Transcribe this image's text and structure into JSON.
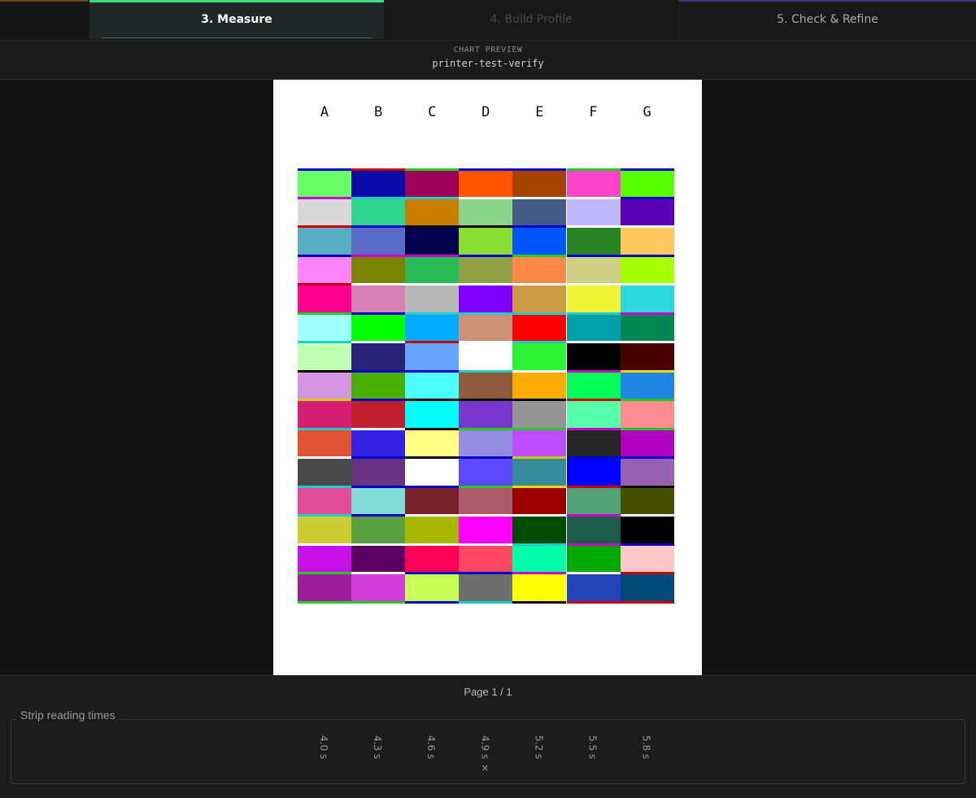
{
  "tabs": [
    {
      "label": "3. Measure",
      "state": "active"
    },
    {
      "label": "4. Build Profile",
      "state": "disabled"
    },
    {
      "label": "5. Check & Refine",
      "state": "normal"
    }
  ],
  "preview": {
    "label": "CHART PREVIEW",
    "name": "printer-test-verify"
  },
  "chart": {
    "columns": [
      "A",
      "B",
      "C",
      "D",
      "E",
      "F",
      "G"
    ],
    "rows": [
      [
        "#66ff66",
        "#0a0aa8",
        "#9e0058",
        "#ff5500",
        "#a44400",
        "#ff44cc",
        "#55ff00"
      ],
      [
        "#d9d9d9",
        "#2ed68f",
        "#c97e00",
        "#8ad48a",
        "#425a84",
        "#c0b8ff",
        "#5a00b4"
      ],
      [
        "#58acc4",
        "#5a6cc8",
        "#00004c",
        "#8ade33",
        "#0056ff",
        "#2a8428",
        "#ffc85c"
      ],
      [
        "#ff84ff",
        "#7a8400",
        "#28bc58",
        "#92a045",
        "#ff8848",
        "#d0d084",
        "#a8ff00"
      ],
      [
        "#ff0090",
        "#d680b4",
        "#b8b8b8",
        "#8000ff",
        "#cc9a44",
        "#f0f234",
        "#2cd8dc"
      ],
      [
        "#a0fffc",
        "#00ff00",
        "#00aaff",
        "#cc9076",
        "#ff0000",
        "#00a0a8",
        "#008652"
      ],
      [
        "#c0ffb4",
        "#2a2278",
        "#66a4ff",
        "#ffffff",
        "#2cf234",
        "#000000",
        "#480000"
      ],
      [
        "#d496e2",
        "#48ae00",
        "#4effff",
        "#8c5c3c",
        "#ffaa00",
        "#00ff56",
        "#1e86e2"
      ],
      [
        "#d61e74",
        "#c02030",
        "#00ffff",
        "#7838cc",
        "#949494",
        "#56ffaa",
        "#ff8c8e"
      ],
      [
        "#e05434",
        "#3420e2",
        "#ffff84",
        "#968ce2",
        "#bc4cff",
        "#262626",
        "#b000c0"
      ],
      [
        "#4a4a4a",
        "#6a3282",
        "#ffffff",
        "#5c48ff",
        "#368a98",
        "#0000ff",
        "#9860b0"
      ],
      [
        "#e04c9a",
        "#80dad8",
        "#78222c",
        "#ac5a6c",
        "#9c0000",
        "#54a27a",
        "#445000"
      ],
      [
        "#cccc34",
        "#5aa042",
        "#a8b800",
        "#ff00ff",
        "#004a00",
        "#1e5c4a",
        "#000000"
      ],
      [
        "#c810e8",
        "#5a0060",
        "#ff0056",
        "#ff4660",
        "#00ffa8",
        "#00aa00",
        "#ffc8c8"
      ],
      [
        "#9c1c9a",
        "#d43cdc",
        "#c8ff56",
        "#6e6e6e",
        "#ffff00",
        "#2244b8",
        "#004a78"
      ]
    ],
    "dividers": [
      [
        "#0000cc",
        "#cc0000",
        "#22cc22",
        "#0000cc",
        "#0000cc",
        "#22cc22",
        "#0000cc"
      ],
      [
        "#cc00cc",
        "#22cccc",
        "#22cccc",
        "#ffffff",
        "#ffffff",
        "#ffffff",
        "#0000cc"
      ],
      [
        "#cc0000",
        "#0000cc",
        "#000000",
        "#000000",
        "#0000cc",
        "#ffffff",
        "#ffffff"
      ],
      [
        "#0000cc",
        "#cc00cc",
        "#cc00cc",
        "#0000cc",
        "#22cc22",
        "#0000cc",
        "#0000cc"
      ],
      [
        "#cc0000",
        "#ffffff",
        "#ffffff",
        "#ffffff",
        "#ffffff",
        "#ffffff",
        "#ffffff"
      ],
      [
        "#22cc22",
        "#0000cc",
        "#22cccc",
        "#22cccc",
        "#22cccc",
        "#22cccc",
        "#cc00cc"
      ],
      [
        "#22cccc",
        "#ffffff",
        "#cc0000",
        "#ffffff",
        "#22cccc",
        "#ffffff",
        "#ffffff"
      ],
      [
        "#000000",
        "#0000cc",
        "#0000cc",
        "#22cccc",
        "#ffffff",
        "#cc00cc",
        "#ffd700"
      ],
      [
        "#cccc00",
        "#0000cc",
        "#000000",
        "#000000",
        "#000000",
        "#cc0000",
        "#22cc22"
      ],
      [
        "#22cccc",
        "#ffffff",
        "#000000",
        "#22cc22",
        "#22cc22",
        "#cc00cc",
        "#22cc22"
      ],
      [
        "#ffffff",
        "#0000cc",
        "#000000",
        "#0000cc",
        "#cccc00",
        "#0000cc",
        "#0000cc"
      ],
      [
        "#22cccc",
        "#0000cc",
        "#0000cc",
        "#22cc22",
        "#ffd700",
        "#cc0000",
        "#000000"
      ],
      [
        "#22cccc",
        "#0000cc",
        "#ffffff",
        "#ffffff",
        "#ffffff",
        "#cc00cc",
        "#ffffff"
      ],
      [
        "#ffffff",
        "#ffffff",
        "#ffffff",
        "#ffffff",
        "#22cccc",
        "#cc00cc",
        "#0000cc"
      ],
      [
        "#22cc22",
        "#ffffff",
        "#0000cc",
        "#0000cc",
        "#cc00cc",
        "#ffffff",
        "#cc0000"
      ],
      [
        "#22cc22",
        "#22cc22",
        "#0000cc",
        "#22cccc",
        "#000000",
        "#cc0000",
        "#cc0000"
      ]
    ]
  },
  "page_indicator": "Page 1 / 1",
  "strip_times": {
    "legend": "Strip reading times",
    "items": [
      "4.0 s",
      "4.3 s",
      "4.6 s",
      "4.9 s ×",
      "5.2 s",
      "5.5 s",
      "5.8 s"
    ]
  },
  "colors": {
    "accent": "#3ddc84",
    "secondary_accent": "#5b4fcf",
    "orange_accent": "#c87000"
  }
}
